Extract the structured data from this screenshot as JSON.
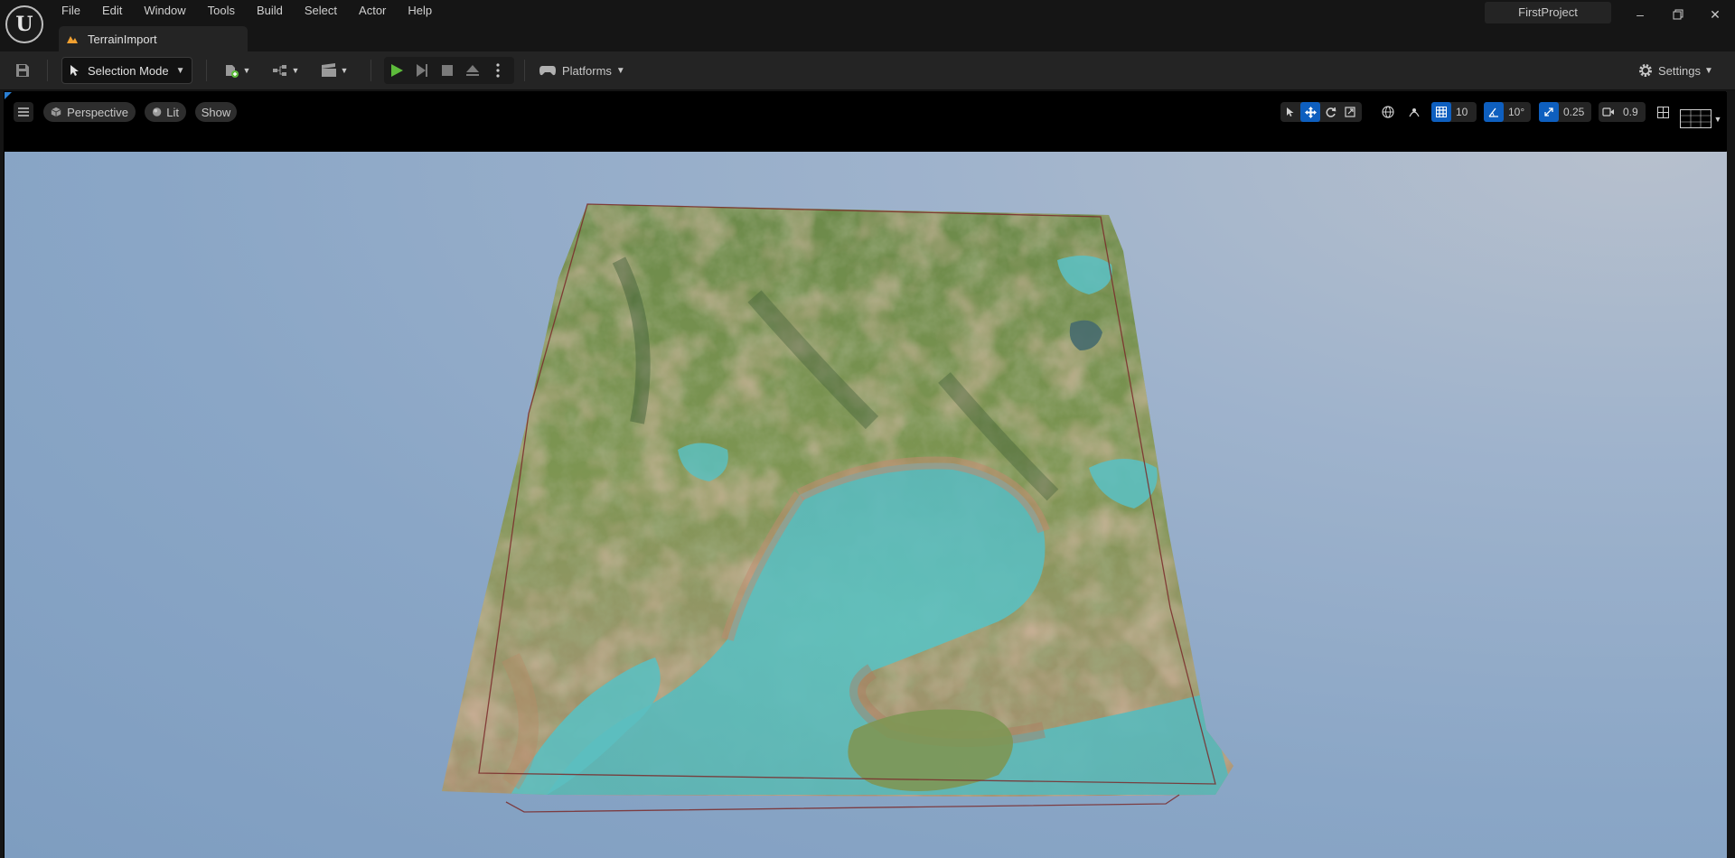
{
  "menu": {
    "items": [
      "File",
      "Edit",
      "Window",
      "Tools",
      "Build",
      "Select",
      "Actor",
      "Help"
    ]
  },
  "document_tab": {
    "label": "TerrainImport"
  },
  "project": {
    "name": "FirstProject"
  },
  "toolbar": {
    "selection_mode_label": "Selection Mode",
    "platforms_label": "Platforms",
    "settings_label": "Settings"
  },
  "viewport": {
    "perspective_label": "Perspective",
    "lit_label": "Lit",
    "show_label": "Show",
    "grid_snap_value": "10",
    "rotation_snap_value": "10°",
    "scale_snap_value": "0.25",
    "camera_speed_value": "0.9"
  },
  "icons": {
    "logo": "unreal-engine-logo",
    "save": "save-icon",
    "play": "play-icon",
    "settings": "gear-icon"
  },
  "colors": {
    "accent": "#0e5fbf",
    "play_green": "#5dbb3b",
    "sky": "#8aa6c6",
    "water": "#5cc0c0",
    "grass": "#7a9a52",
    "bounds": "#7a2a2a"
  }
}
